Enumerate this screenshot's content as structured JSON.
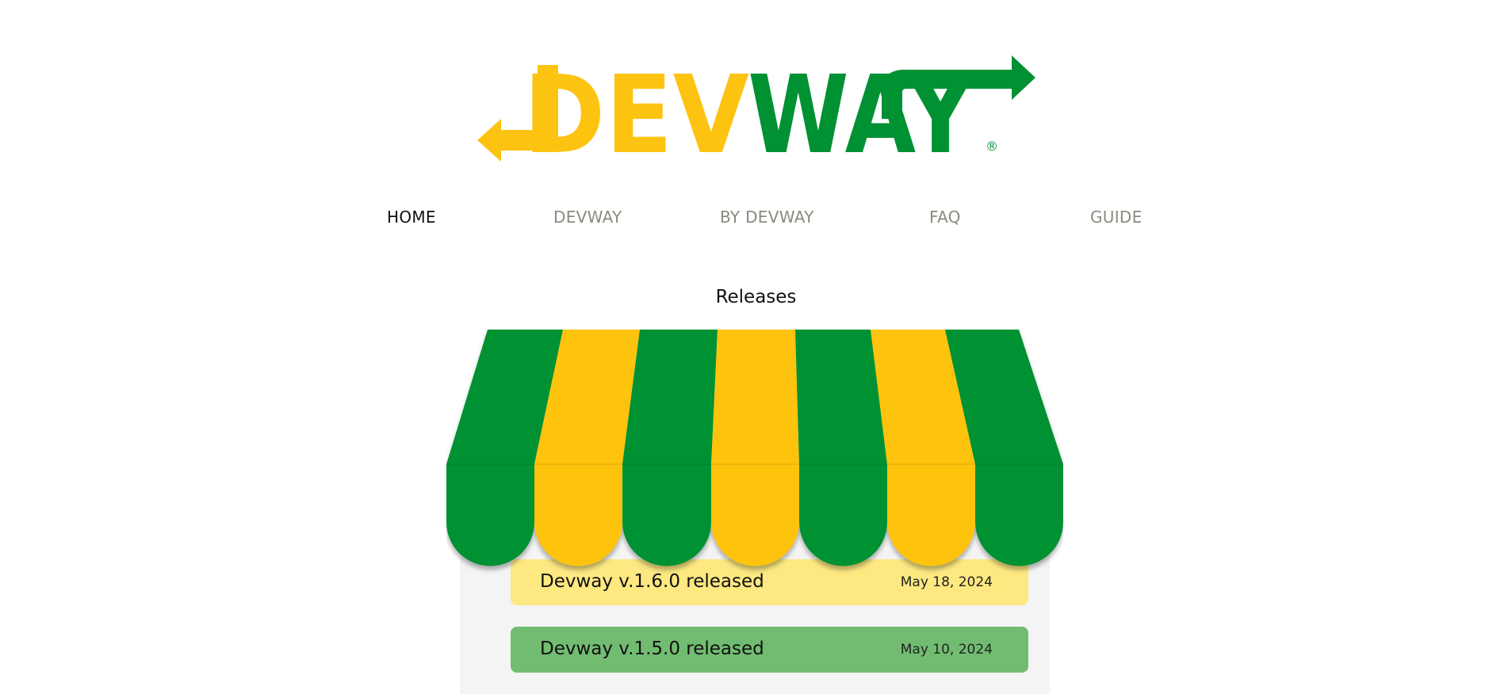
{
  "brand": {
    "part1": "DEV",
    "part2": "WAY",
    "registered": "®",
    "colors": {
      "yellow": "#FDC311",
      "green": "#009133"
    }
  },
  "nav": {
    "items": [
      {
        "label": "HOME",
        "active": true
      },
      {
        "label": "DEVWAY",
        "active": false
      },
      {
        "label": "BY DEVWAY",
        "active": false
      },
      {
        "label": "FAQ",
        "active": false
      },
      {
        "label": "GUIDE",
        "active": false
      }
    ]
  },
  "releases": {
    "title": "Releases",
    "items": [
      {
        "title": "Devway v.1.6.0 released",
        "date": "May 18, 2024",
        "color": "#FDE881"
      },
      {
        "title": "Devway v.1.5.0 released",
        "date": "May 10, 2024",
        "color": "#72BC72"
      }
    ]
  }
}
